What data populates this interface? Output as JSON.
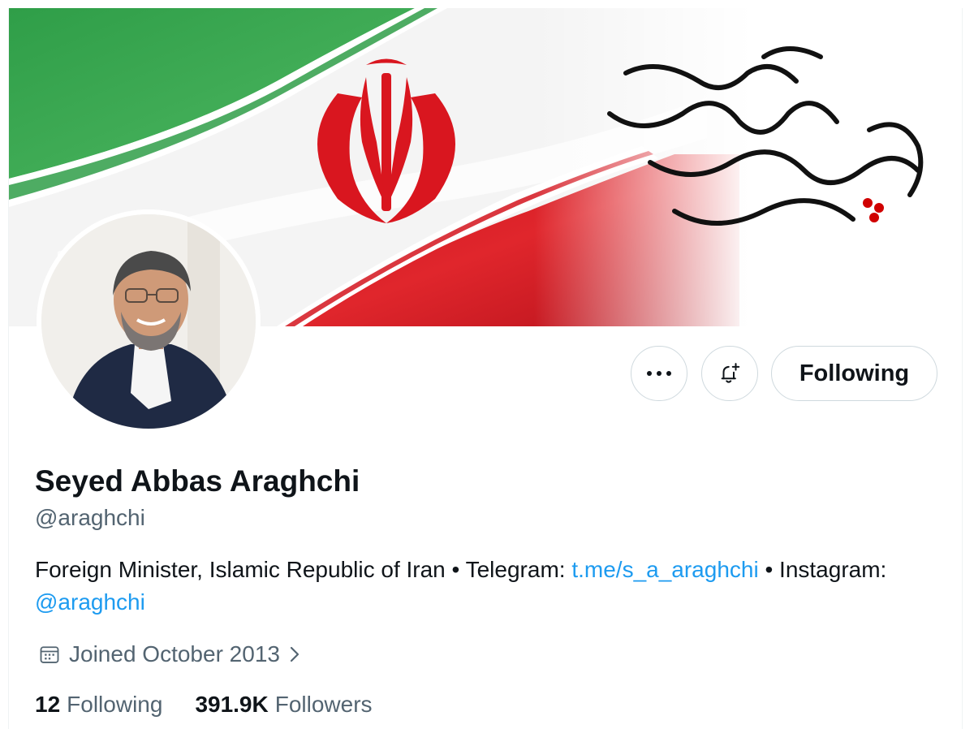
{
  "profile": {
    "display_name": "Seyed Abbas Araghchi",
    "handle": "@araghchi",
    "bio": {
      "text_1": "Foreign Minister, Islamic Republic of Iran • Telegram: ",
      "link_1": "t.me/s_a_araghchi",
      "text_2": " • Instagram: ",
      "link_2": "@araghchi"
    },
    "joined": "Joined October 2013",
    "stats": {
      "following_count": "12",
      "following_label": "Following",
      "followers_count": "391.9K",
      "followers_label": "Followers"
    }
  },
  "actions": {
    "more_icon": "more-horizontal-icon",
    "notify_icon": "bell-plus-icon",
    "follow_label": "Following"
  },
  "banner": {
    "calligraphy_text": "چو ایران نباشد تن من مباد",
    "flag_colors": {
      "green": "#239f40",
      "white": "#ffffff",
      "red": "#da0000"
    }
  },
  "colors": {
    "text_primary": "#0f1419",
    "text_secondary": "#536471",
    "link": "#1d9bf0",
    "border": "#cfd9de"
  }
}
